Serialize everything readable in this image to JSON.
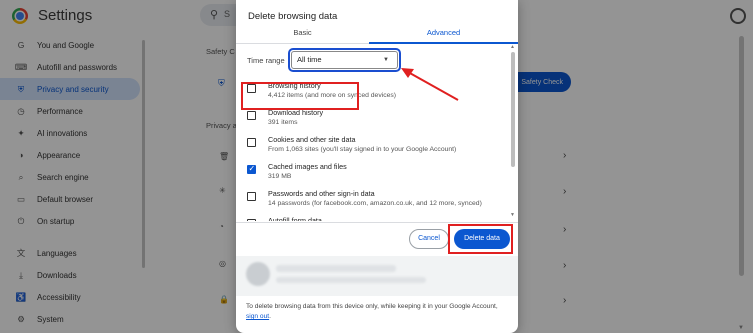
{
  "app": {
    "title": "Settings",
    "search_placeholder": "S"
  },
  "sidebar": {
    "items": [
      {
        "icon": "G",
        "label": "You and Google",
        "active": false
      },
      {
        "icon": "⌨",
        "label": "Autofill and passwords",
        "active": false
      },
      {
        "icon": "⛨",
        "label": "Privacy and security",
        "active": true
      },
      {
        "icon": "◷",
        "label": "Performance",
        "active": false
      },
      {
        "icon": "✦",
        "label": "AI innovations",
        "active": false
      },
      {
        "icon": "◑",
        "label": "Appearance",
        "active": false
      },
      {
        "icon": "⌕",
        "label": "Search engine",
        "active": false
      },
      {
        "icon": "▭",
        "label": "Default browser",
        "active": false
      },
      {
        "icon": "⏻",
        "label": "On startup",
        "active": false
      },
      {
        "icon": "文",
        "label": "Languages",
        "active": false
      },
      {
        "icon": "⤓",
        "label": "Downloads",
        "active": false
      },
      {
        "icon": "♿",
        "label": "Accessibility",
        "active": false
      },
      {
        "icon": "⚙",
        "label": "System",
        "active": false
      }
    ]
  },
  "background": {
    "safety_label": "Safety C",
    "safety_button": "Safety Check",
    "privacy_label": "Privacy a"
  },
  "dialog": {
    "title": "Delete browsing data",
    "tabs": {
      "basic": "Basic",
      "advanced": "Advanced"
    },
    "time_range": {
      "label": "Time range",
      "value": "All time"
    },
    "options": [
      {
        "title": "Browsing history",
        "subtitle": "4,412 items (and more on synced devices)",
        "checked": false
      },
      {
        "title": "Download history",
        "subtitle": "391 items",
        "checked": false
      },
      {
        "title": "Cookies and other site data",
        "subtitle": "From 1,063 sites (you'll stay signed in to your Google Account)",
        "checked": false
      },
      {
        "title": "Cached images and files",
        "subtitle": "319 MB",
        "checked": true
      },
      {
        "title": "Passwords and other sign-in data",
        "subtitle": "14 passwords (for facebook.com, amazon.co.uk, and 12 more, synced)",
        "checked": false
      },
      {
        "title": "Autofill form data",
        "subtitle": "",
        "checked": false
      }
    ],
    "cancel_label": "Cancel",
    "delete_label": "Delete data",
    "footer_text": "To delete browsing data from this device only, while keeping it in your Google Account,",
    "footer_link": "sign out",
    "footer_end": "."
  },
  "colors": {
    "accent": "#0b57d0",
    "annotation_red": "#e02020"
  }
}
